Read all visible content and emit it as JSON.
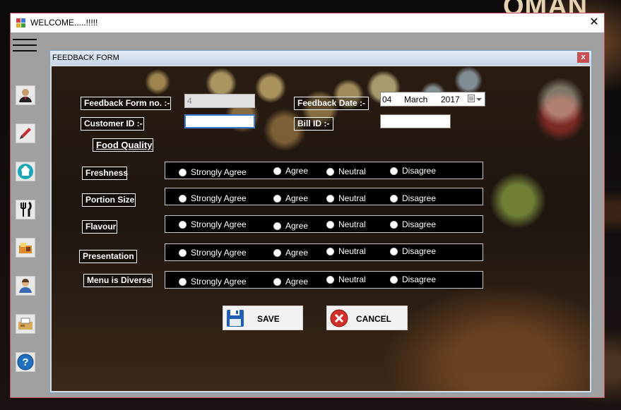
{
  "window": {
    "title": "WELCOME.....!!!!!",
    "close_glyph": "✕"
  },
  "desktop_fragment": "OMAN",
  "toolbar": {
    "items": [
      {
        "icon": "user-icon"
      },
      {
        "icon": "pen-icon"
      },
      {
        "icon": "chef-hat-icon"
      },
      {
        "icon": "fork-knife-icon"
      },
      {
        "icon": "food-order-icon"
      },
      {
        "icon": "customer-icon"
      },
      {
        "icon": "billing-icon"
      },
      {
        "icon": "help-icon",
        "glyph": "?"
      }
    ]
  },
  "form": {
    "title": "FEEDBACK FORM",
    "close_glyph": "x",
    "labels": {
      "form_no": "Feedback Form no. :-",
      "date": "Feedback Date :-",
      "customer_id": "Customer ID :-",
      "bill_id": "Bill ID :-",
      "section": "Food Quality"
    },
    "fields": {
      "form_no_value": "4",
      "customer_id_value": "",
      "bill_id_value": ""
    },
    "date_picker": {
      "day": "04",
      "month": "March",
      "year": "2017"
    },
    "criteria": [
      "Freshness",
      "Portion Size",
      "Flavour",
      "Presentation",
      "Menu is Diverse"
    ],
    "options": [
      "Strongly Agree",
      "Agree",
      "Neutral",
      "Disagree"
    ],
    "buttons": {
      "save": "SAVE",
      "cancel": "CANCEL"
    }
  },
  "colors": {
    "accent_blue": "#3a7bd5",
    "form_close": "#c75050",
    "window_border": "#c04a5a"
  }
}
